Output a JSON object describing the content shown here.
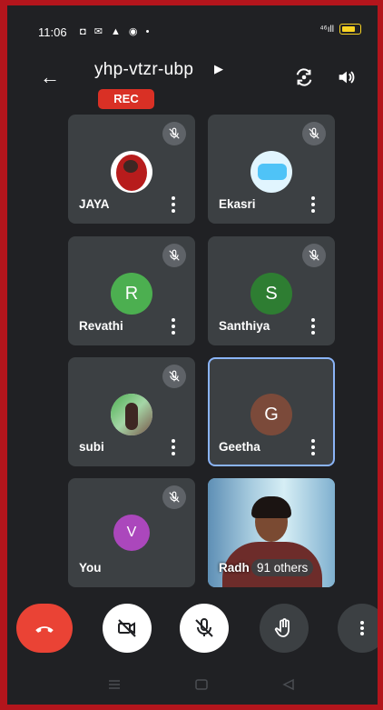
{
  "status": {
    "time": "11:06",
    "notification_icons": "◘ ✉ ▲ ◉ •",
    "signal": "⁴⁶ıll"
  },
  "header": {
    "meeting_code": "yhp-vtzr-ubp",
    "rec_label": "REC"
  },
  "participants": [
    {
      "name": "JAYA",
      "initial": "",
      "avatar_color": "#b71c1c",
      "muted": true
    },
    {
      "name": "Ekasri",
      "initial": "",
      "avatar_color": "#b3e5fc",
      "muted": true
    },
    {
      "name": "Revathi",
      "initial": "R",
      "avatar_color": "#4caf50",
      "muted": true
    },
    {
      "name": "Santhiya",
      "initial": "S",
      "avatar_color": "#2e7d32",
      "muted": true
    },
    {
      "name": "subi",
      "initial": "",
      "avatar_color": "#9e9e9e",
      "muted": true
    },
    {
      "name": "Geetha",
      "initial": "G",
      "avatar_color": "#7b4a3a",
      "muted": false,
      "active_speaker": true
    },
    {
      "name": "You",
      "initial": "V",
      "avatar_color": "#ab47bc",
      "muted": true
    }
  ],
  "others_tile": {
    "label": "Radh",
    "count": "91 others"
  },
  "colors": {
    "background": "#202124",
    "tile": "#3c4043",
    "end_call": "#ea4335",
    "active_border": "#8ab4f8",
    "frame": "#b3151c"
  }
}
